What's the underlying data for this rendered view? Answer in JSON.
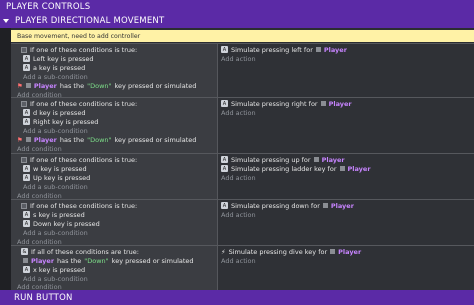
{
  "groups": {
    "player_controls": "PLAYER CONTROLS",
    "player_movement": "PLAYER DIRECTIONAL MOVEMENT",
    "run_button": "RUN BUTTON"
  },
  "comment": "Base movement, need to add controller",
  "add_condition": "Add condition",
  "add_subcondition": "Add a sub-condition",
  "add_action": "Add action",
  "events": [
    {
      "header": "If one of these conditions is true:",
      "conditions": [
        "Left key is pressed",
        "a key is pressed"
      ],
      "player_cond": {
        "pre": "Player",
        "mid": "has the",
        "key": "\"Down\"",
        "post": "key pressed or simulated"
      },
      "actions": [
        "Simulate pressing left for",
        "Player"
      ]
    },
    {
      "header": "If one of these conditions is true:",
      "conditions": [
        "d key is pressed",
        "Right key is pressed"
      ],
      "player_cond": {
        "pre": "Player",
        "mid": "has the",
        "key": "\"Down\"",
        "post": "key pressed or simulated"
      },
      "actions": [
        "Simulate pressing right for",
        "Player"
      ]
    },
    {
      "header": "If one of these conditions is true:",
      "conditions": [
        "w key is pressed",
        "Up key is pressed"
      ],
      "actions": [
        "Simulate pressing up for",
        "Player"
      ],
      "actions2": [
        "Simulate pressing ladder key for",
        "Player"
      ]
    },
    {
      "header": "If one of these conditions is true:",
      "conditions": [
        "s key is pressed",
        "Down key is pressed"
      ],
      "actions": [
        "Simulate pressing down for",
        "Player"
      ]
    },
    {
      "header": "If all of these conditions are true:",
      "player_cond": {
        "pre": "Player",
        "mid": "has the",
        "key": "\"Down\"",
        "post": "key pressed or simulated"
      },
      "conditions": [
        "x key is pressed"
      ],
      "actions": [
        "Simulate pressing dive key for",
        "Player"
      ]
    }
  ]
}
